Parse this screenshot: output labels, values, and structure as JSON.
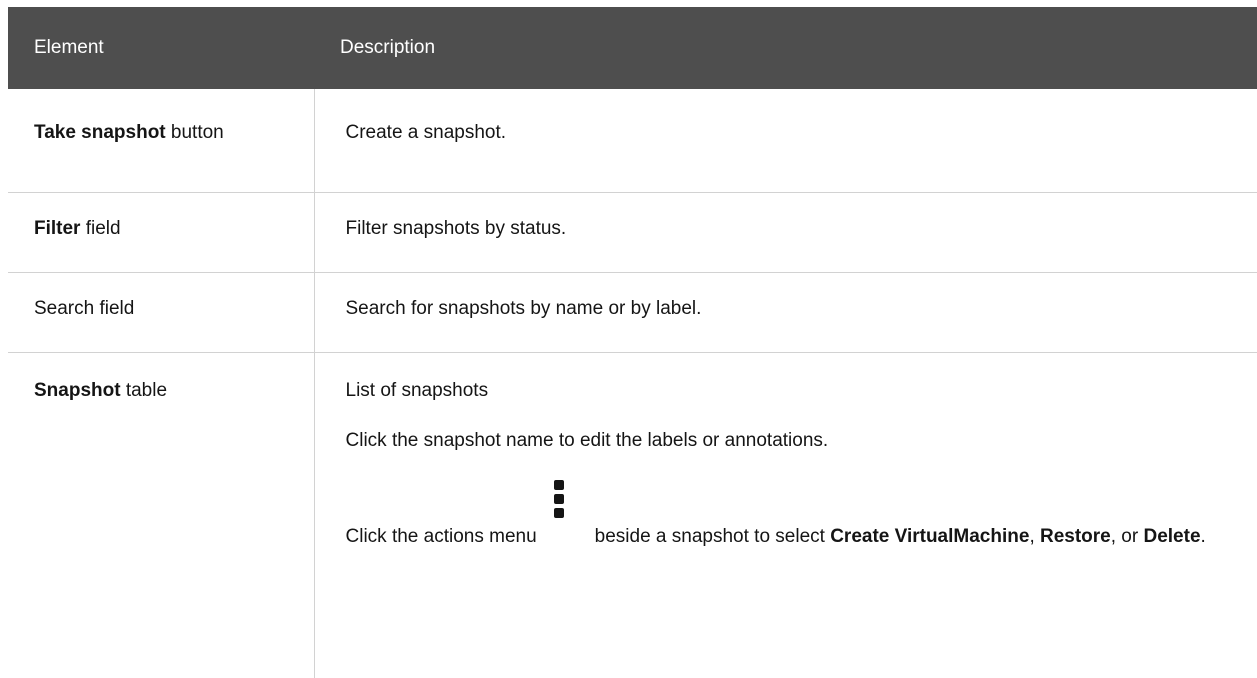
{
  "table": {
    "headers": [
      "Element",
      "Description"
    ],
    "rows": [
      {
        "element_strong": "Take snapshot",
        "element_rest": " button",
        "description": "Create a snapshot."
      },
      {
        "element_strong": "Filter",
        "element_rest": " field",
        "description": "Filter snapshots by status."
      },
      {
        "element_strong": "",
        "element_rest": "Search field",
        "description": "Search for snapshots by name or by label."
      },
      {
        "element_strong": "Snapshot",
        "element_rest": " table",
        "description_p1": "List of snapshots",
        "description_p2": "Click the snapshot name to edit the labels or annotations.",
        "description_p3_pre": "Click the actions menu",
        "description_p3_post": "beside a snapshot to select ",
        "action_create": "Create VirtualMachine",
        "sep1": ", ",
        "action_restore": "Restore",
        "sep2": ", or ",
        "action_delete": "Delete",
        "end": "."
      }
    ]
  },
  "icons": {
    "actions_menu": "kebab-vertical-icon"
  }
}
